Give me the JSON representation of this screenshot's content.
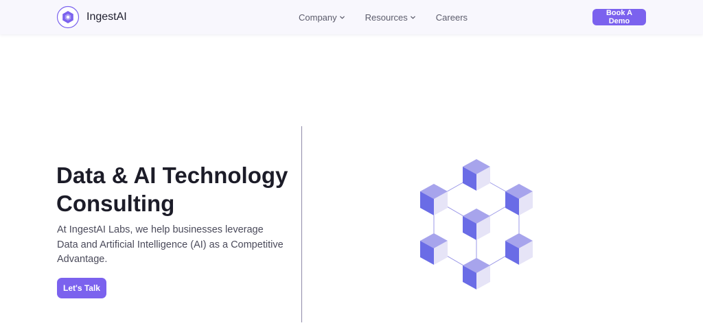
{
  "header": {
    "brand": "IngestAI",
    "nav": [
      {
        "label": "Company",
        "has_dropdown": true
      },
      {
        "label": "Resources",
        "has_dropdown": true
      },
      {
        "label": "Careers",
        "has_dropdown": false
      }
    ],
    "cta_label": "Book A Demo"
  },
  "hero": {
    "title": "Data & AI Technology Consulting",
    "description": "At IngestAI Labs, we help businesses leverage Data and Artificial Intelligence (AI) as a Competitive Advantage.",
    "cta_label": "Let's Talk"
  },
  "colors": {
    "accent": "#7b62ee",
    "cube_top": "#a7a4ec",
    "cube_left": "#6a6ce6",
    "cube_right": "#e6e4f7"
  },
  "icons": {
    "logo": "hexagon-logo-icon",
    "dropdown": "chevron-down-icon",
    "illustration": "cube-network-icon"
  }
}
